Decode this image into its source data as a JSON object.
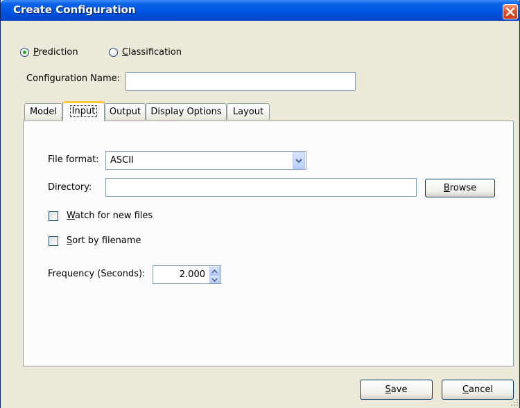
{
  "window": {
    "title": "Create Configuration"
  },
  "mode": {
    "options": [
      {
        "label": "Prediction",
        "selected": true
      },
      {
        "label": "Classification",
        "selected": false
      }
    ]
  },
  "config_name": {
    "label": "Configuration Name:",
    "value": ""
  },
  "tabs": [
    {
      "label": "Model",
      "active": false
    },
    {
      "label": "Input",
      "active": true
    },
    {
      "label": "Output",
      "active": false
    },
    {
      "label": "Display Options",
      "active": false
    },
    {
      "label": "Layout",
      "active": false
    }
  ],
  "input_tab": {
    "file_format": {
      "label": "File format:",
      "value": "ASCII"
    },
    "directory": {
      "label": "Directory:",
      "value": "",
      "browse_label": "Browse"
    },
    "watch_new_files": {
      "label": "Watch for new files",
      "checked": false
    },
    "sort_by_filename": {
      "label": "Sort by filename",
      "checked": false
    },
    "frequency": {
      "label": "Frequency (Seconds):",
      "value": "2.000"
    }
  },
  "footer": {
    "save_label": "Save",
    "cancel_label": "Cancel"
  },
  "colors": {
    "titlebar": "#0054e3",
    "dialog_bg": "#ece9d8",
    "tab_highlight": "#ffc83c",
    "radio_dot": "#21a121"
  }
}
